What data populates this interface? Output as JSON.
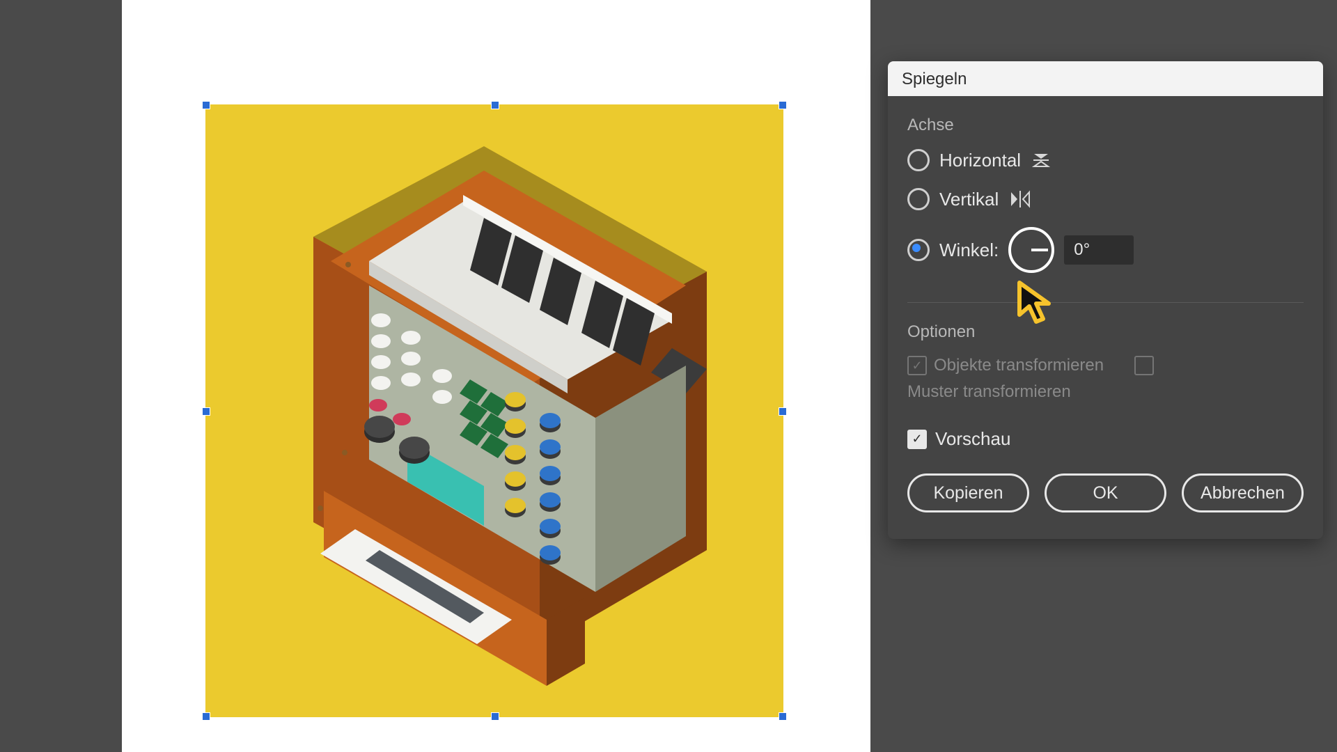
{
  "dialog": {
    "title": "Spiegeln",
    "axis_label": "Achse",
    "horizontal_label": "Horizontal",
    "vertical_label": "Vertikal",
    "angle_label": "Winkel:",
    "angle_value": "0°",
    "selected_axis": "angle",
    "options_label": "Optionen",
    "transform_objects_label": "Objekte transformieren",
    "transform_objects_checked": true,
    "transform_objects_disabled": true,
    "transform_patterns_label": "Muster transformieren",
    "transform_patterns_checked": false,
    "transform_patterns_disabled": true,
    "preview_label": "Vorschau",
    "preview_checked": true,
    "copy_label": "Kopieren",
    "ok_label": "OK",
    "cancel_label": "Abbrechen"
  },
  "artwork": {
    "description": "Isometric synthesizer illustration",
    "background": "#ebca2e",
    "colors": {
      "wood_light": "#c6641d",
      "wood_med": "#a74f17",
      "wood_dark": "#7d3c11",
      "olive_top": "#a68c1e",
      "panel": "#aeb5a3",
      "screen": "#39c0b1",
      "white": "#f3f3f0",
      "black": "#2f2f2f",
      "grey": "#555"
    }
  }
}
